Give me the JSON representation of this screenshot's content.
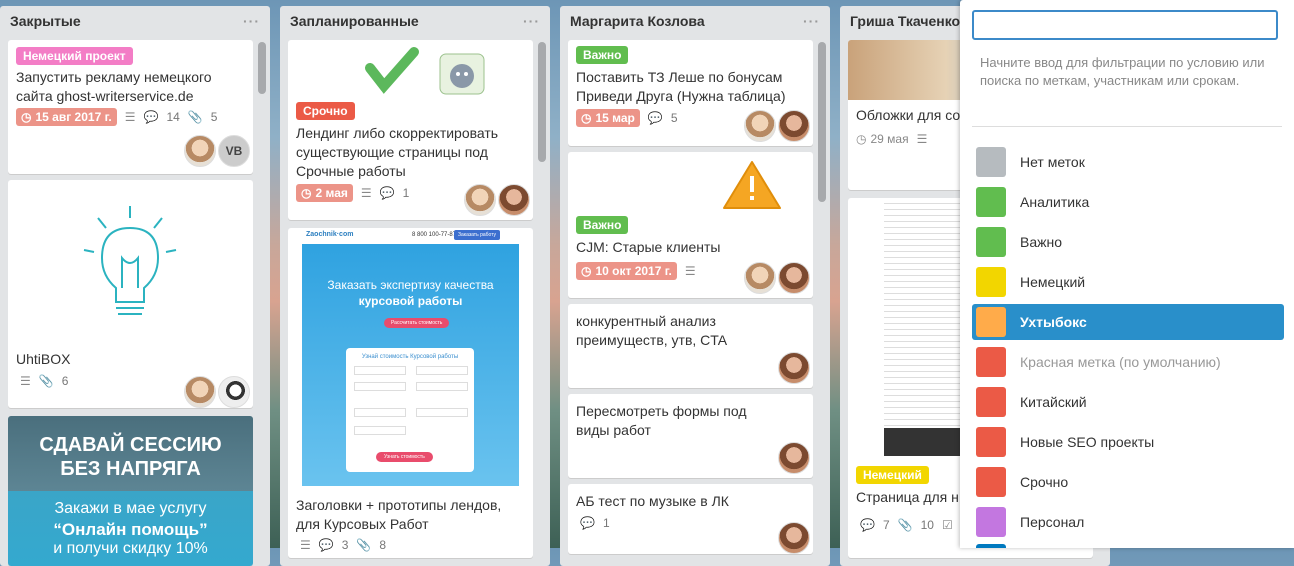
{
  "lists": [
    {
      "title": "Закрытые",
      "menu": "···",
      "cards": [
        {
          "label": "Немецкий проект",
          "label_color": "#f37dc6",
          "title": "Запустить рекламу немецкого сайта ghost-writerservice.de",
          "due": "15 авг 2017 г.",
          "comments": "14",
          "attachments": "5",
          "avatars": [
            "photo",
            "VB"
          ]
        },
        {
          "title": "UhtiBOX",
          "attachments": "6"
        },
        {
          "banner_line1": "СДАВАЙ СЕССИЮ",
          "banner_line2": "БЕЗ НАПРЯГА",
          "banner_line3": "Закажи в мае услугу",
          "banner_line4": "“Онлайн помощь”",
          "banner_line5": "и получи скидку 10%"
        }
      ]
    },
    {
      "title": "Запланированные",
      "menu": "···",
      "cards": [
        {
          "label": "Срочно",
          "label_color": "#eb5a46",
          "title": "Лендинг либо скорректировать существующие страницы под Срочные работы",
          "due": "2 мая",
          "comments": "1"
        },
        {
          "site_logo": "Zaochnik·com",
          "site_phone": "8 800 100-77-87",
          "site_button": "Заказать работу",
          "hero_line1": "Заказать экспертизу качества",
          "hero_line2": "курсовой работы",
          "hero_button": "Рассчитать стоимость",
          "form_title": "Узнай стоимость Курсовой работы",
          "form_submit": "Узнать стоимость",
          "title": "Заголовки + прототипы лендов, для Курсовых Работ",
          "comments": "3",
          "attachments": "8"
        }
      ]
    },
    {
      "title": "Маргарита Козлова",
      "menu": "···",
      "cards": [
        {
          "label": "Важно",
          "label_color": "#61bd4f",
          "title": "Поставить ТЗ Леше по бонусам Приведи Друга (Нужна таблица)",
          "due": "15 мар",
          "comments": "5"
        },
        {
          "label": "Важно",
          "label_color": "#61bd4f",
          "title": "CJM: Старые клиенты",
          "due": "10 окт 2017 г."
        },
        {
          "title": "конкурентный анализ преимуществ, утв, CTA"
        },
        {
          "title": "Пересмотреть формы под виды работ"
        },
        {
          "title": "АБ тест по музыке в ЛК",
          "comments": "1"
        }
      ]
    },
    {
      "title": "Гриша Ткаченко",
      "cards": [
        {
          "title": "Обложки для со",
          "due": "29 мая"
        },
        {
          "label": "Немецкий",
          "label_color": "#f2d600",
          "title": "Страница для н",
          "comments": "7",
          "attachments": "10"
        }
      ]
    }
  ],
  "filter": {
    "placeholder": "",
    "hint": "Начните ввод для фильтрации по условию или поиска по меткам, участникам или срокам.",
    "labels": [
      {
        "name": "Нет меток",
        "color": "#b6bbbf"
      },
      {
        "name": "Аналитика",
        "color": "#61bd4f"
      },
      {
        "name": "Важно",
        "color": "#61bd4f"
      },
      {
        "name": "Немецкий",
        "color": "#f2d600"
      },
      {
        "name": "Ухтыбокс",
        "color": "#ffab4a",
        "active": true
      },
      {
        "name": "Красная метка (по умолчанию)",
        "color": "#eb5a46"
      },
      {
        "name": "Китайский",
        "color": "#eb5a46"
      },
      {
        "name": "Новые SEO проекты",
        "color": "#eb5a46"
      },
      {
        "name": "Срочно",
        "color": "#eb5a46"
      },
      {
        "name": "Персонал",
        "color": "#c377e0"
      }
    ]
  }
}
